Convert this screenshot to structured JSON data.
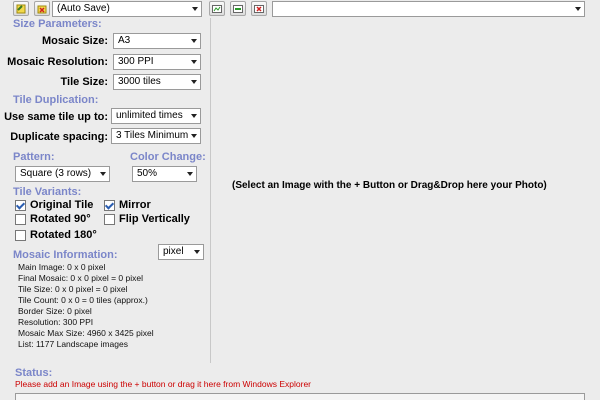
{
  "toolbar": {
    "preset_value": "(Auto Save)",
    "image_selector_value": ""
  },
  "left": {
    "size_section": "Size Parameters:",
    "mosaic_size_label": "Mosaic Size:",
    "mosaic_size_value": "A3",
    "resolution_label": "Mosaic Resolution:",
    "resolution_value": "300 PPI",
    "tile_size_label": "Tile Size:",
    "tile_size_value": "3000 tiles",
    "dup_section": "Tile Duplication:",
    "same_tile_label": "Use same tile up to:",
    "same_tile_value": "unlimited times",
    "dup_spacing_label": "Duplicate spacing:",
    "dup_spacing_value": "3 Tiles Minimum",
    "pattern_section": "Pattern:",
    "pattern_value": "Square (3 rows)",
    "color_section": "Color Change:",
    "color_value": "50%",
    "variants_section": "Tile Variants:",
    "variants": [
      {
        "label": "Original Tile",
        "checked": true
      },
      {
        "label": "Mirror",
        "checked": true
      },
      {
        "label": "Rotated 90°",
        "checked": false
      },
      {
        "label": "Flip Vertically",
        "checked": false
      },
      {
        "label": "Rotated 180°",
        "checked": false
      }
    ],
    "info_section": "Mosaic Information:",
    "unit_value": "pixel",
    "info_lines": [
      "Main Image: 0 x 0 pixel",
      "Final Mosaic: 0 x 0 pixel = 0 pixel",
      "Tile Size: 0 x 0 pixel = 0 pixel",
      "Tile Count: 0 x 0 = 0 tiles (approx.)",
      "Border Size: 0 pixel",
      "Resolution: 300 PPI",
      "Mosaic Max Size: 4960 x 3425 pixel",
      "List: 1177 Landscape images"
    ]
  },
  "main": {
    "drop_message": "(Select an Image with the + Button or Drag&Drop here your Photo)"
  },
  "status": {
    "title": "Status:",
    "message": "Please add an Image using the + button or drag it here from Windows Explorer"
  },
  "colors": {
    "section": "#7b86c9",
    "status_error": "#cc0000"
  }
}
